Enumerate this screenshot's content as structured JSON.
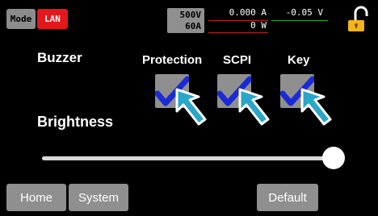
{
  "status_bar": {
    "mode_label": "Mode",
    "lan_label": "LAN",
    "rated_voltage": "500V",
    "rated_current": "60A",
    "measured_current": "0.000 A",
    "measured_voltage": "-0.05 V",
    "measured_power": "0 W",
    "lock_icon": "lock-icon",
    "colors": {
      "lan": "#e4171d",
      "current_line": "#c21a1a",
      "voltage_line": "#1bb02c",
      "lock": "#f2b51a"
    }
  },
  "settings": {
    "buzzer_label": "Buzzer",
    "brightness_label": "Brightness",
    "checkboxes": [
      {
        "label": "Protection",
        "checked": true
      },
      {
        "label": "SCPI",
        "checked": true
      },
      {
        "label": "Key",
        "checked": true
      }
    ],
    "brightness_value": 1.0,
    "checkmark_color": "#1a2bd6",
    "pointer_color": "#2aa6c9"
  },
  "footer": {
    "home_label": "Home",
    "system_label": "System",
    "default_label": "Default"
  }
}
